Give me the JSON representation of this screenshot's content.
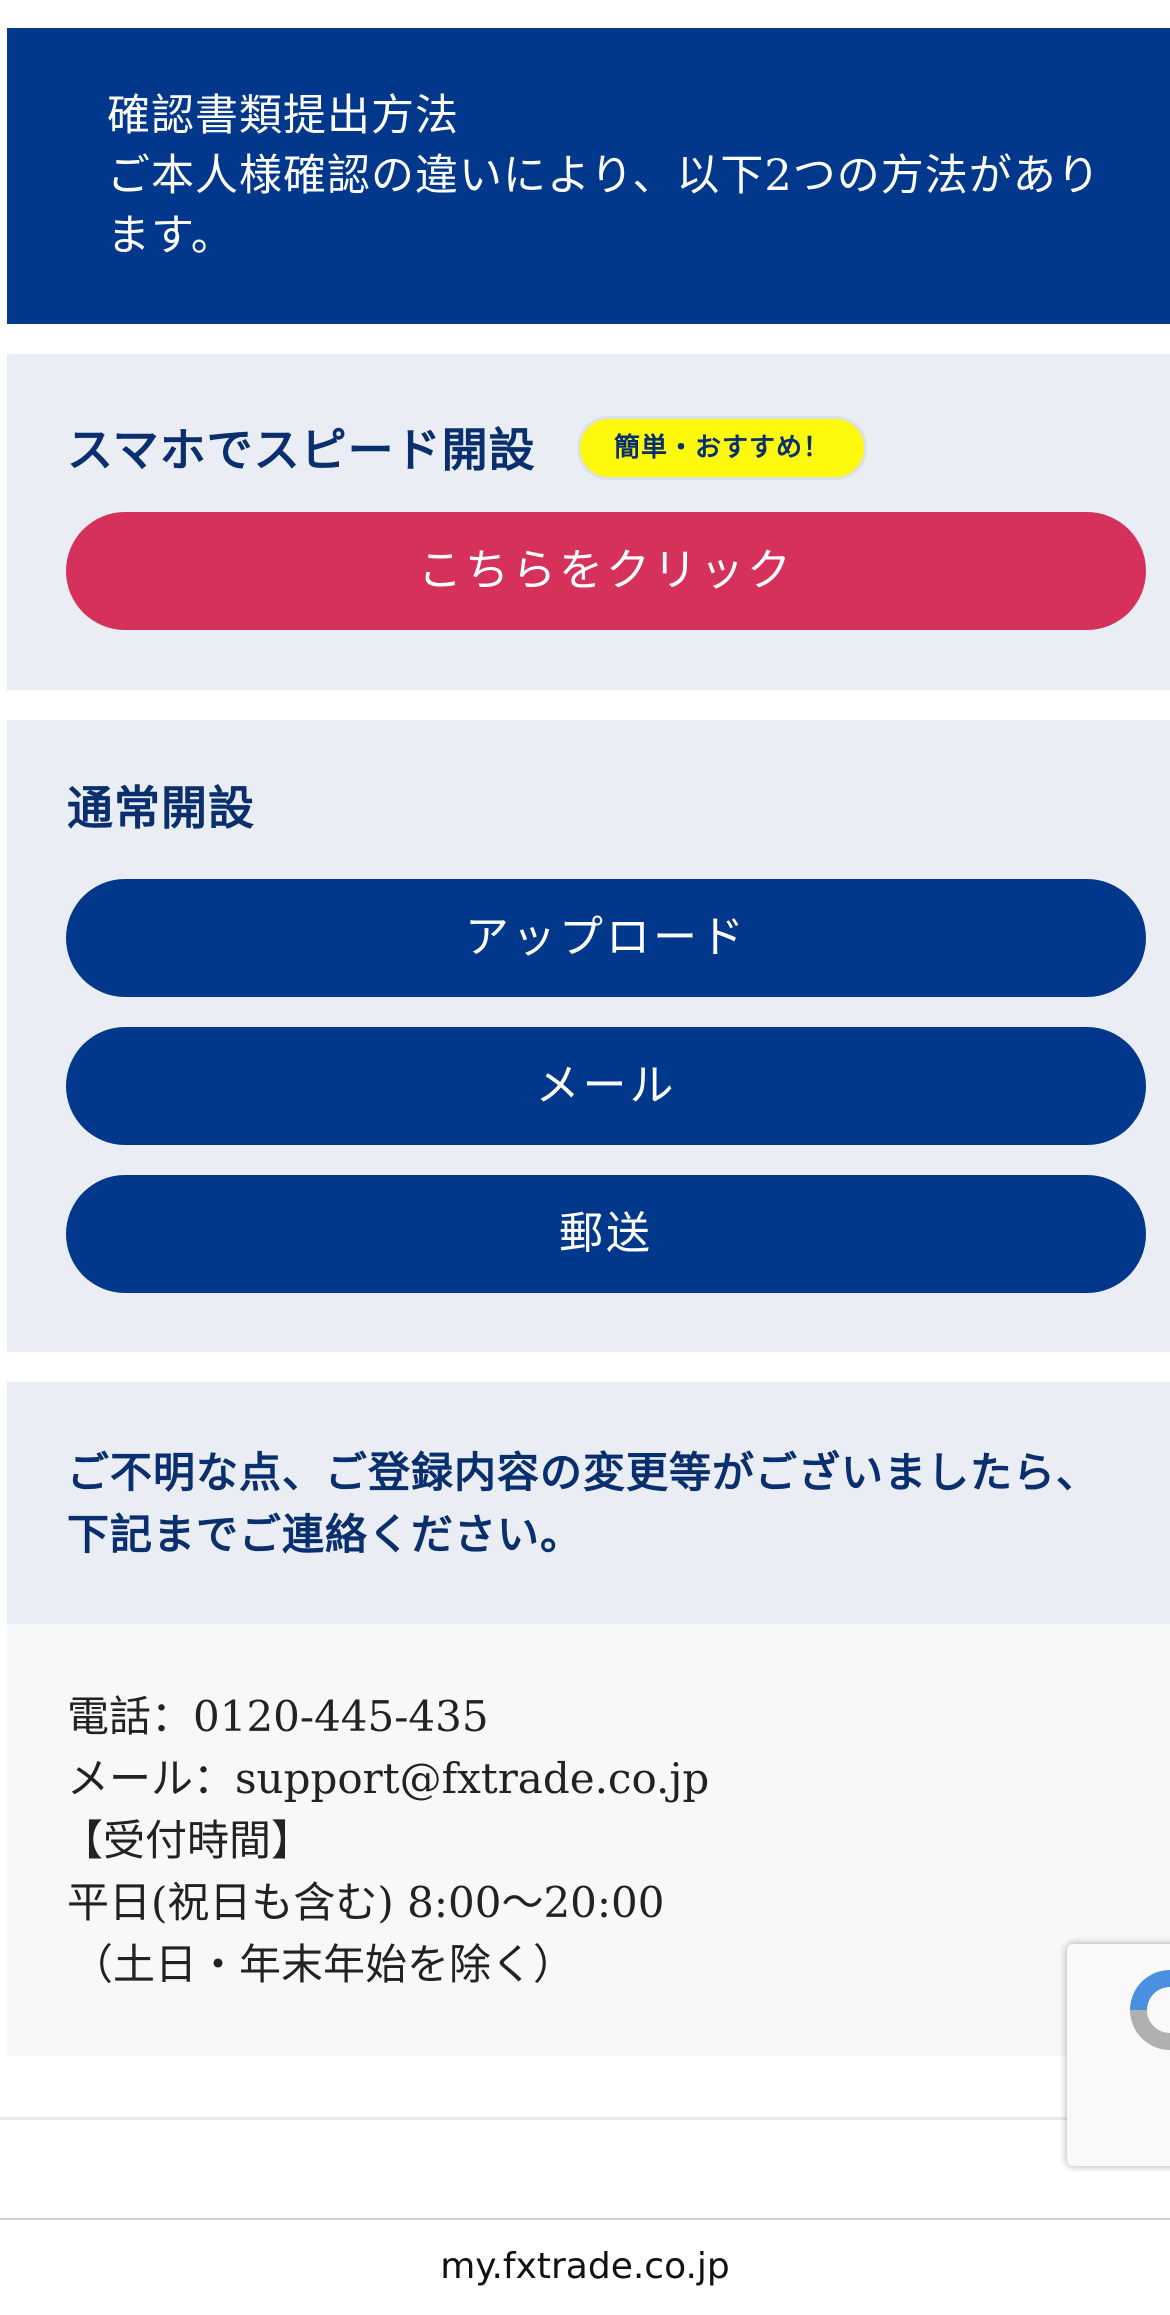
{
  "header": {
    "line1": "確認書類提出方法",
    "line2": "ご本人様確認の違いにより、以下2つの方法があります。"
  },
  "speed_section": {
    "title": "スマホでスピード開設",
    "badge": "簡単・おすすめ！",
    "button": "こちらをクリック"
  },
  "normal_section": {
    "title": "通常開設",
    "buttons": [
      "アップロード",
      "メール",
      "郵送"
    ]
  },
  "contact": {
    "message": "ご不明な点、ご登録内容の変更等がございましたら、下記までご連絡ください。",
    "phone": "電話：0120-445-435",
    "email": "メール：support@fxtrade.co.jp",
    "hours_label": "【受付時間】",
    "hours": "平日(祝日も含む) 8:00〜20:00",
    "exclusions": "（土日・年末年始を除く）"
  },
  "browser": {
    "url": "my.fxtrade.co.jp"
  },
  "colors": {
    "navy": "#02388c",
    "cta_red": "#d6315a",
    "badge_yellow": "#fcf90c",
    "panel_gray": "#eaeef4"
  },
  "icons": {
    "recaptcha": "recaptcha-icon"
  }
}
